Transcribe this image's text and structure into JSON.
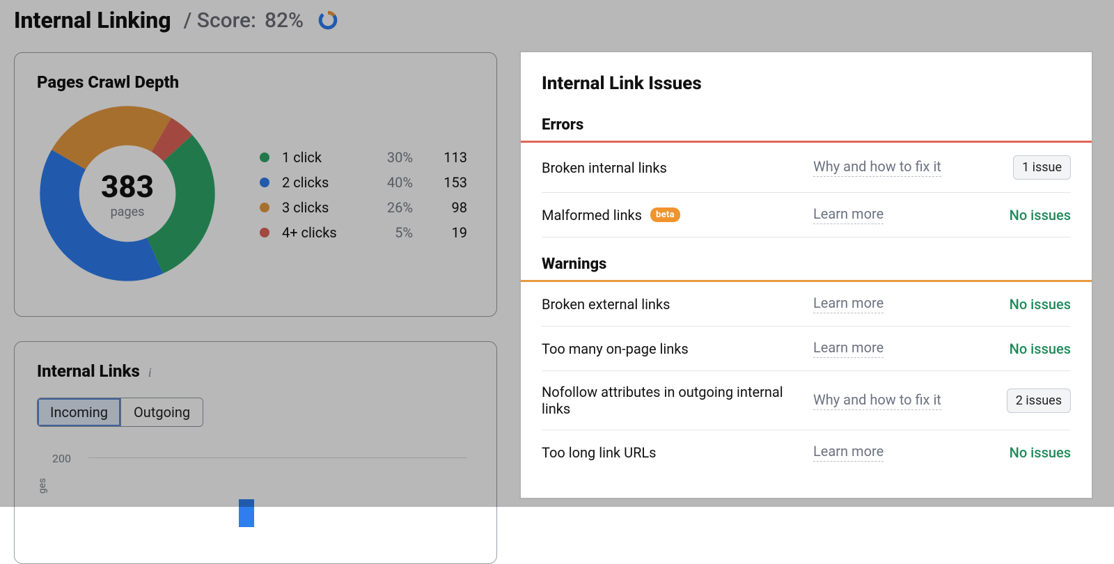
{
  "header": {
    "title": "Internal Linking",
    "score_prefix": "/ Score: ",
    "score_value": "82%"
  },
  "colors": {
    "green": "#2fa868",
    "blue": "#2f7def",
    "orange": "#e89a40",
    "red": "#e0665a"
  },
  "crawl_depth": {
    "title": "Pages Crawl Depth",
    "total": "383",
    "total_label": "pages",
    "legend": [
      {
        "label": "1 click",
        "pct": "30%",
        "count": "113",
        "color": "#2fa868"
      },
      {
        "label": "2 clicks",
        "pct": "40%",
        "count": "153",
        "color": "#2f7def"
      },
      {
        "label": "3 clicks",
        "pct": "26%",
        "count": "98",
        "color": "#e89a40"
      },
      {
        "label": "4+ clicks",
        "pct": "5%",
        "count": "19",
        "color": "#e0665a"
      }
    ]
  },
  "internal_links": {
    "title": "Internal Links",
    "tabs": {
      "incoming": "Incoming",
      "outgoing": "Outgoing"
    },
    "yaxis_title": "ges",
    "yticks": {
      "t200": "200"
    }
  },
  "issues_panel": {
    "title": "Internal Link Issues",
    "errors_label": "Errors",
    "warnings_label": "Warnings",
    "errors": [
      {
        "title": "Broken internal links",
        "link_text": "Why and how to fix it",
        "status": "1 issue",
        "status_type": "badge"
      },
      {
        "title": "Malformed links",
        "beta": "beta",
        "link_text": "Learn more",
        "status": "No issues",
        "status_type": "ok"
      }
    ],
    "warnings": [
      {
        "title": "Broken external links",
        "link_text": "Learn more",
        "status": "No issues",
        "status_type": "ok"
      },
      {
        "title": "Too many on-page links",
        "link_text": "Learn more",
        "status": "No issues",
        "status_type": "ok"
      },
      {
        "title": "Nofollow attributes in outgoing internal links",
        "link_text": "Why and how to fix it",
        "status": "2 issues",
        "status_type": "badge"
      },
      {
        "title": "Too long link URLs",
        "link_text": "Learn more",
        "status": "No issues",
        "status_type": "ok"
      }
    ]
  },
  "chart_data": {
    "donut": {
      "type": "pie",
      "title": "Pages Crawl Depth",
      "categories": [
        "1 click",
        "2 clicks",
        "3 clicks",
        "4+ clicks"
      ],
      "values": [
        113,
        153,
        98,
        19
      ],
      "percent": [
        30,
        40,
        26,
        5
      ],
      "total": 383,
      "colors": [
        "#2fa868",
        "#2f7def",
        "#e89a40",
        "#e0665a"
      ]
    },
    "mini_donut": {
      "type": "pie",
      "score_percent": 82
    }
  }
}
